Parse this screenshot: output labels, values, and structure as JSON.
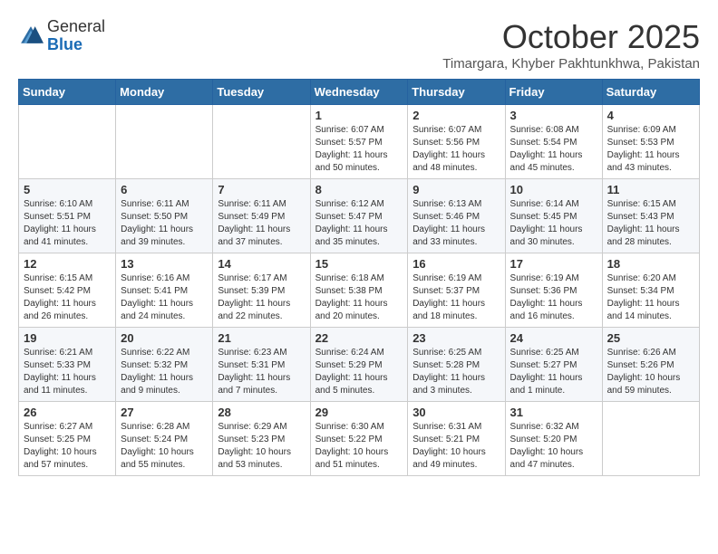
{
  "header": {
    "logo_line1": "General",
    "logo_line2": "Blue",
    "month": "October 2025",
    "location": "Timargara, Khyber Pakhtunkhwa, Pakistan"
  },
  "weekdays": [
    "Sunday",
    "Monday",
    "Tuesday",
    "Wednesday",
    "Thursday",
    "Friday",
    "Saturday"
  ],
  "weeks": [
    [
      {
        "day": "",
        "info": ""
      },
      {
        "day": "",
        "info": ""
      },
      {
        "day": "",
        "info": ""
      },
      {
        "day": "1",
        "info": "Sunrise: 6:07 AM\nSunset: 5:57 PM\nDaylight: 11 hours\nand 50 minutes."
      },
      {
        "day": "2",
        "info": "Sunrise: 6:07 AM\nSunset: 5:56 PM\nDaylight: 11 hours\nand 48 minutes."
      },
      {
        "day": "3",
        "info": "Sunrise: 6:08 AM\nSunset: 5:54 PM\nDaylight: 11 hours\nand 45 minutes."
      },
      {
        "day": "4",
        "info": "Sunrise: 6:09 AM\nSunset: 5:53 PM\nDaylight: 11 hours\nand 43 minutes."
      }
    ],
    [
      {
        "day": "5",
        "info": "Sunrise: 6:10 AM\nSunset: 5:51 PM\nDaylight: 11 hours\nand 41 minutes."
      },
      {
        "day": "6",
        "info": "Sunrise: 6:11 AM\nSunset: 5:50 PM\nDaylight: 11 hours\nand 39 minutes."
      },
      {
        "day": "7",
        "info": "Sunrise: 6:11 AM\nSunset: 5:49 PM\nDaylight: 11 hours\nand 37 minutes."
      },
      {
        "day": "8",
        "info": "Sunrise: 6:12 AM\nSunset: 5:47 PM\nDaylight: 11 hours\nand 35 minutes."
      },
      {
        "day": "9",
        "info": "Sunrise: 6:13 AM\nSunset: 5:46 PM\nDaylight: 11 hours\nand 33 minutes."
      },
      {
        "day": "10",
        "info": "Sunrise: 6:14 AM\nSunset: 5:45 PM\nDaylight: 11 hours\nand 30 minutes."
      },
      {
        "day": "11",
        "info": "Sunrise: 6:15 AM\nSunset: 5:43 PM\nDaylight: 11 hours\nand 28 minutes."
      }
    ],
    [
      {
        "day": "12",
        "info": "Sunrise: 6:15 AM\nSunset: 5:42 PM\nDaylight: 11 hours\nand 26 minutes."
      },
      {
        "day": "13",
        "info": "Sunrise: 6:16 AM\nSunset: 5:41 PM\nDaylight: 11 hours\nand 24 minutes."
      },
      {
        "day": "14",
        "info": "Sunrise: 6:17 AM\nSunset: 5:39 PM\nDaylight: 11 hours\nand 22 minutes."
      },
      {
        "day": "15",
        "info": "Sunrise: 6:18 AM\nSunset: 5:38 PM\nDaylight: 11 hours\nand 20 minutes."
      },
      {
        "day": "16",
        "info": "Sunrise: 6:19 AM\nSunset: 5:37 PM\nDaylight: 11 hours\nand 18 minutes."
      },
      {
        "day": "17",
        "info": "Sunrise: 6:19 AM\nSunset: 5:36 PM\nDaylight: 11 hours\nand 16 minutes."
      },
      {
        "day": "18",
        "info": "Sunrise: 6:20 AM\nSunset: 5:34 PM\nDaylight: 11 hours\nand 14 minutes."
      }
    ],
    [
      {
        "day": "19",
        "info": "Sunrise: 6:21 AM\nSunset: 5:33 PM\nDaylight: 11 hours\nand 11 minutes."
      },
      {
        "day": "20",
        "info": "Sunrise: 6:22 AM\nSunset: 5:32 PM\nDaylight: 11 hours\nand 9 minutes."
      },
      {
        "day": "21",
        "info": "Sunrise: 6:23 AM\nSunset: 5:31 PM\nDaylight: 11 hours\nand 7 minutes."
      },
      {
        "day": "22",
        "info": "Sunrise: 6:24 AM\nSunset: 5:29 PM\nDaylight: 11 hours\nand 5 minutes."
      },
      {
        "day": "23",
        "info": "Sunrise: 6:25 AM\nSunset: 5:28 PM\nDaylight: 11 hours\nand 3 minutes."
      },
      {
        "day": "24",
        "info": "Sunrise: 6:25 AM\nSunset: 5:27 PM\nDaylight: 11 hours\nand 1 minute."
      },
      {
        "day": "25",
        "info": "Sunrise: 6:26 AM\nSunset: 5:26 PM\nDaylight: 10 hours\nand 59 minutes."
      }
    ],
    [
      {
        "day": "26",
        "info": "Sunrise: 6:27 AM\nSunset: 5:25 PM\nDaylight: 10 hours\nand 57 minutes."
      },
      {
        "day": "27",
        "info": "Sunrise: 6:28 AM\nSunset: 5:24 PM\nDaylight: 10 hours\nand 55 minutes."
      },
      {
        "day": "28",
        "info": "Sunrise: 6:29 AM\nSunset: 5:23 PM\nDaylight: 10 hours\nand 53 minutes."
      },
      {
        "day": "29",
        "info": "Sunrise: 6:30 AM\nSunset: 5:22 PM\nDaylight: 10 hours\nand 51 minutes."
      },
      {
        "day": "30",
        "info": "Sunrise: 6:31 AM\nSunset: 5:21 PM\nDaylight: 10 hours\nand 49 minutes."
      },
      {
        "day": "31",
        "info": "Sunrise: 6:32 AM\nSunset: 5:20 PM\nDaylight: 10 hours\nand 47 minutes."
      },
      {
        "day": "",
        "info": ""
      }
    ]
  ]
}
